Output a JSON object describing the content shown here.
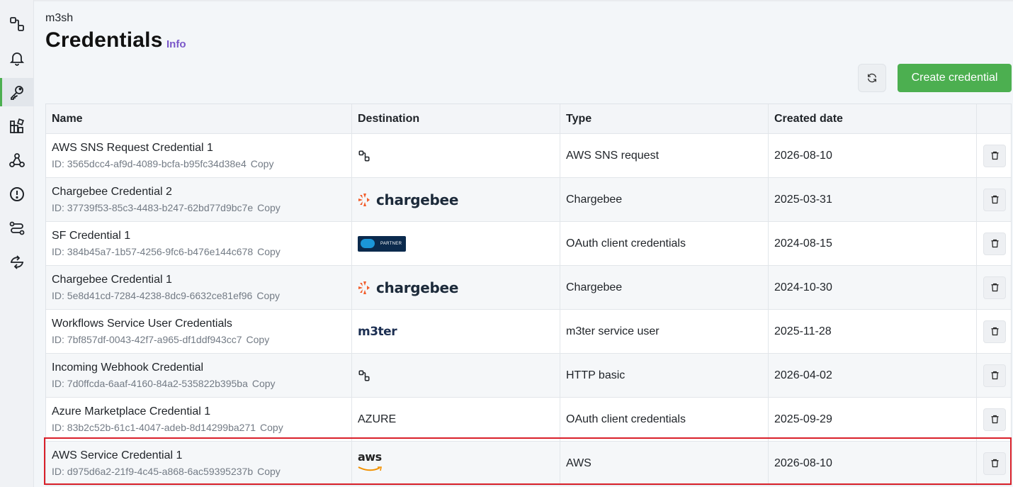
{
  "org_name": "m3sh",
  "page_title": "Credentials",
  "info_label": "Info",
  "create_button_label": "Create credential",
  "colors": {
    "accent_green": "#4caf50",
    "info_purple": "#7a57c9",
    "highlight_red": "#d9202a"
  },
  "sidebar": {
    "items": [
      {
        "icon": "integrations-icon"
      },
      {
        "icon": "bell-icon"
      },
      {
        "icon": "key-icon",
        "active": true
      },
      {
        "icon": "apps-icon"
      },
      {
        "icon": "webhook-icon"
      },
      {
        "icon": "alert-icon"
      },
      {
        "icon": "workflow-icon"
      },
      {
        "icon": "sync-icon"
      }
    ]
  },
  "table": {
    "columns": [
      "Name",
      "Destination",
      "Type",
      "Created date"
    ],
    "copy_label": "Copy",
    "id_prefix": "ID: ",
    "rows": [
      {
        "name": "AWS SNS Request Credential 1",
        "id": "3565dcc4-af9d-4089-bcfa-b95fc34d38e4",
        "destination": "integration-icon",
        "type": "AWS SNS request",
        "created": "2026-08-10"
      },
      {
        "name": "Chargebee Credential 2",
        "id": "37739f53-85c3-4483-b247-62bd77d9bc7e",
        "destination": "chargebee",
        "destination_text": "chargebee",
        "type": "Chargebee",
        "created": "2025-03-31"
      },
      {
        "name": "SF Credential 1",
        "id": "384b45a7-1b57-4256-9fc6-b476e144c678",
        "destination": "salesforce-partner",
        "destination_text": "PARTNER",
        "type": "OAuth client credentials",
        "created": "2024-08-15"
      },
      {
        "name": "Chargebee Credential 1",
        "id": "5e8d41cd-7284-4238-8dc9-6632ce81ef96",
        "destination": "chargebee",
        "destination_text": "chargebee",
        "type": "Chargebee",
        "created": "2024-10-30"
      },
      {
        "name": "Workflows Service User Credentials",
        "id": "7bf857df-0043-42f7-a965-df1ddf943cc7",
        "destination": "m3ter",
        "destination_text": "m3ter",
        "type": "m3ter service user",
        "created": "2025-11-28"
      },
      {
        "name": "Incoming Webhook Credential",
        "id": "7d0ffcda-6aaf-4160-84a2-535822b395ba",
        "destination": "integration-icon",
        "type": "HTTP basic",
        "created": "2026-04-02"
      },
      {
        "name": "Azure Marketplace Credential 1",
        "id": "83b2c52b-61c1-4047-adeb-8d14299ba271",
        "destination": "text",
        "destination_text": "AZURE",
        "type": "OAuth client credentials",
        "created": "2025-09-29"
      },
      {
        "name": "AWS Service Credential 1",
        "id": "d975d6a2-21f9-4c45-a868-6ac59395237b",
        "destination": "aws",
        "destination_text": "aws",
        "type": "AWS",
        "created": "2026-08-10",
        "highlighted": true
      }
    ]
  }
}
